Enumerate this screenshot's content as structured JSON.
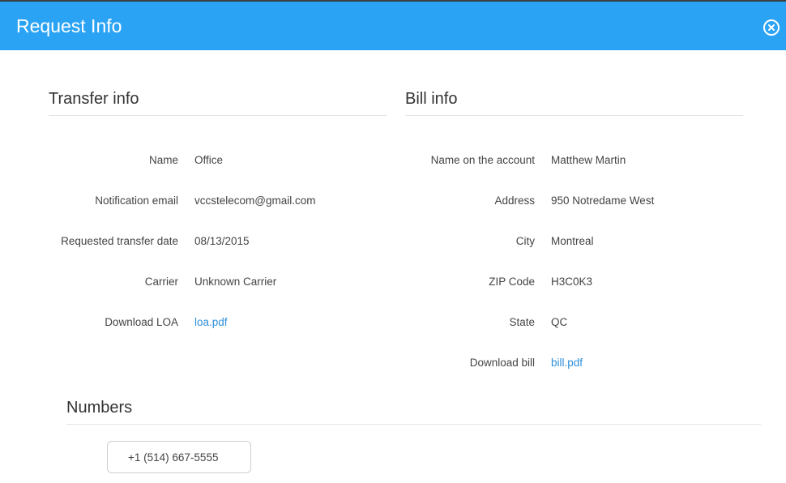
{
  "header": {
    "title": "Request Info",
    "close_icon": "close-circle-icon"
  },
  "transfer": {
    "title": "Transfer info",
    "rows": [
      {
        "label": "Name",
        "value": "Office"
      },
      {
        "label": "Notification email",
        "value": "vccstelecom@gmail.com"
      },
      {
        "label": "Requested transfer date",
        "value": "08/13/2015"
      },
      {
        "label": "Carrier",
        "value": "Unknown Carrier"
      },
      {
        "label": "Download LOA",
        "value": "loa.pdf"
      }
    ]
  },
  "bill": {
    "title": "Bill info",
    "rows": [
      {
        "label": "Name on the account",
        "value": "Matthew Martin"
      },
      {
        "label": "Address",
        "value": "950 Notredame West"
      },
      {
        "label": "City",
        "value": "Montreal"
      },
      {
        "label": "ZIP Code",
        "value": "H3C0K3"
      },
      {
        "label": "State",
        "value": "QC"
      },
      {
        "label": "Download bill",
        "value": "bill.pdf"
      }
    ]
  },
  "numbers": {
    "title": "Numbers",
    "items": [
      "+1 (514) 667-5555"
    ]
  },
  "colors": {
    "header_bg": "#2aa3f5",
    "link": "#2f8fd8"
  }
}
